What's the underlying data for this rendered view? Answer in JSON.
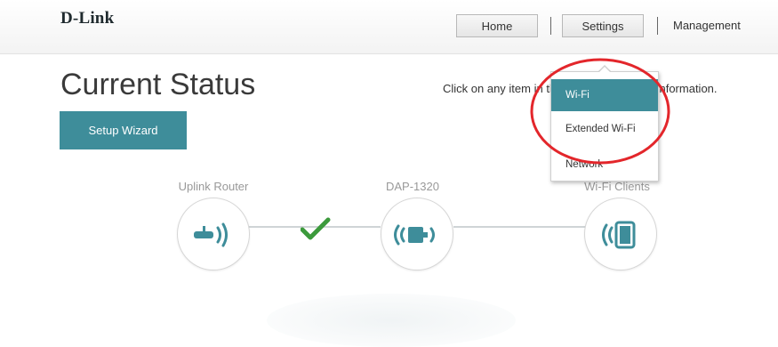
{
  "brand": {
    "logo_text": "D-Link"
  },
  "nav": {
    "home_label": "Home",
    "settings_label": "Settings",
    "management_label": "Management"
  },
  "page": {
    "title": "Current Status",
    "hint": "Click on any item in the diagram for more information.",
    "setup_wizard_label": "Setup Wizard"
  },
  "diagram": {
    "nodes": [
      {
        "label": "Uplink Router",
        "icon": "router-icon"
      },
      {
        "label": "DAP-1320",
        "icon": "extender-icon"
      },
      {
        "label": "Wi-Fi Clients",
        "icon": "tablet-icon"
      }
    ],
    "link_status": "connected-check"
  },
  "settings_menu": {
    "items": [
      {
        "label": "Wi-Fi",
        "selected": true
      },
      {
        "label": "Extended Wi-Fi",
        "selected": false
      },
      {
        "label": "Network",
        "selected": false
      }
    ]
  },
  "colors": {
    "accent": "#3e8d9a",
    "annotation": "#e3262b",
    "check": "#3c9a3c"
  }
}
